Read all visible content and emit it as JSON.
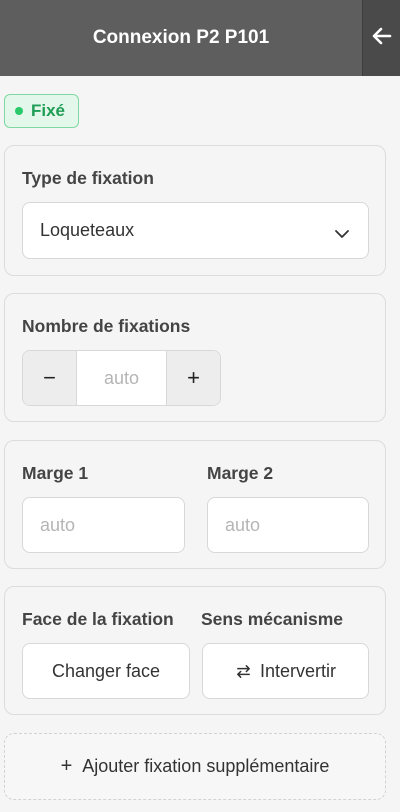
{
  "header": {
    "title": "Connexion P2 P101",
    "back_icon": "arrow-left-icon"
  },
  "status_badge": {
    "label": "Fixé",
    "color": "#2cc96a"
  },
  "fixation_type": {
    "label": "Type de fixation",
    "selected": "Loqueteaux"
  },
  "fixation_count": {
    "label": "Nombre de fixations",
    "minus": "−",
    "plus": "+",
    "placeholder": "auto"
  },
  "margins": {
    "margin1": {
      "label": "Marge 1",
      "placeholder": "auto"
    },
    "margin2": {
      "label": "Marge 2",
      "placeholder": "auto"
    }
  },
  "face_section": {
    "face_label": "Face de la fixation",
    "direction_label": "Sens mécanisme",
    "change_face_button": "Changer face",
    "swap_button": "Intervertir"
  },
  "add_button": {
    "plus": "+",
    "label": "Ajouter fixation supplémentaire"
  }
}
